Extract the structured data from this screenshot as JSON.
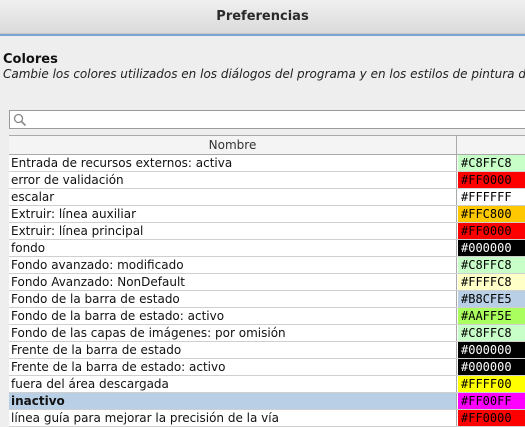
{
  "window": {
    "title": "Preferencias"
  },
  "section": {
    "title": "Colores",
    "description": "Cambie los colores utilizados en los diálogos del programa y en los estilos de pintura de"
  },
  "search": {
    "value": "",
    "placeholder": ""
  },
  "table": {
    "header_name": "Nombre",
    "rows": [
      {
        "name": "Entrada de recursos externos: activa",
        "color": "#C8FFC8",
        "text_color": "#000000"
      },
      {
        "name": "error de validación",
        "color": "#FF0000",
        "text_color": "#000000"
      },
      {
        "name": "escalar",
        "color": "#FFFFFF",
        "text_color": "#000000"
      },
      {
        "name": "Extruir: línea auxiliar",
        "color": "#FFC800",
        "text_color": "#000000"
      },
      {
        "name": "Extruir: línea principal",
        "color": "#FF0000",
        "text_color": "#000000"
      },
      {
        "name": "fondo",
        "color": "#000000",
        "text_color": "#FFFFFF"
      },
      {
        "name": "Fondo avanzado: modificado",
        "color": "#C8FFC8",
        "text_color": "#000000"
      },
      {
        "name": "Fondo Avanzado: NonDefault",
        "color": "#FFFFC8",
        "text_color": "#000000"
      },
      {
        "name": "Fondo de la barra de estado",
        "color": "#B8CFE5",
        "text_color": "#000000"
      },
      {
        "name": "Fondo de la barra de estado: activo",
        "color": "#AAFF5E",
        "text_color": "#000000"
      },
      {
        "name": "Fondo de las capas de imágenes: por omisión",
        "color": "#C8FFC8",
        "text_color": "#000000"
      },
      {
        "name": "Frente de la barra de estado",
        "color": "#000000",
        "text_color": "#FFFFFF"
      },
      {
        "name": "Frente de la barra de estado: activo",
        "color": "#000000",
        "text_color": "#FFFFFF"
      },
      {
        "name": "fuera del área descargada",
        "color": "#FFFF00",
        "text_color": "#000000"
      },
      {
        "name": "inactivo",
        "color": "#FF00FF",
        "text_color": "#000000",
        "selected": true
      },
      {
        "name": "línea guía para mejorar la precisión de la vía",
        "color": "#FF0000",
        "text_color": "#000000"
      }
    ]
  }
}
